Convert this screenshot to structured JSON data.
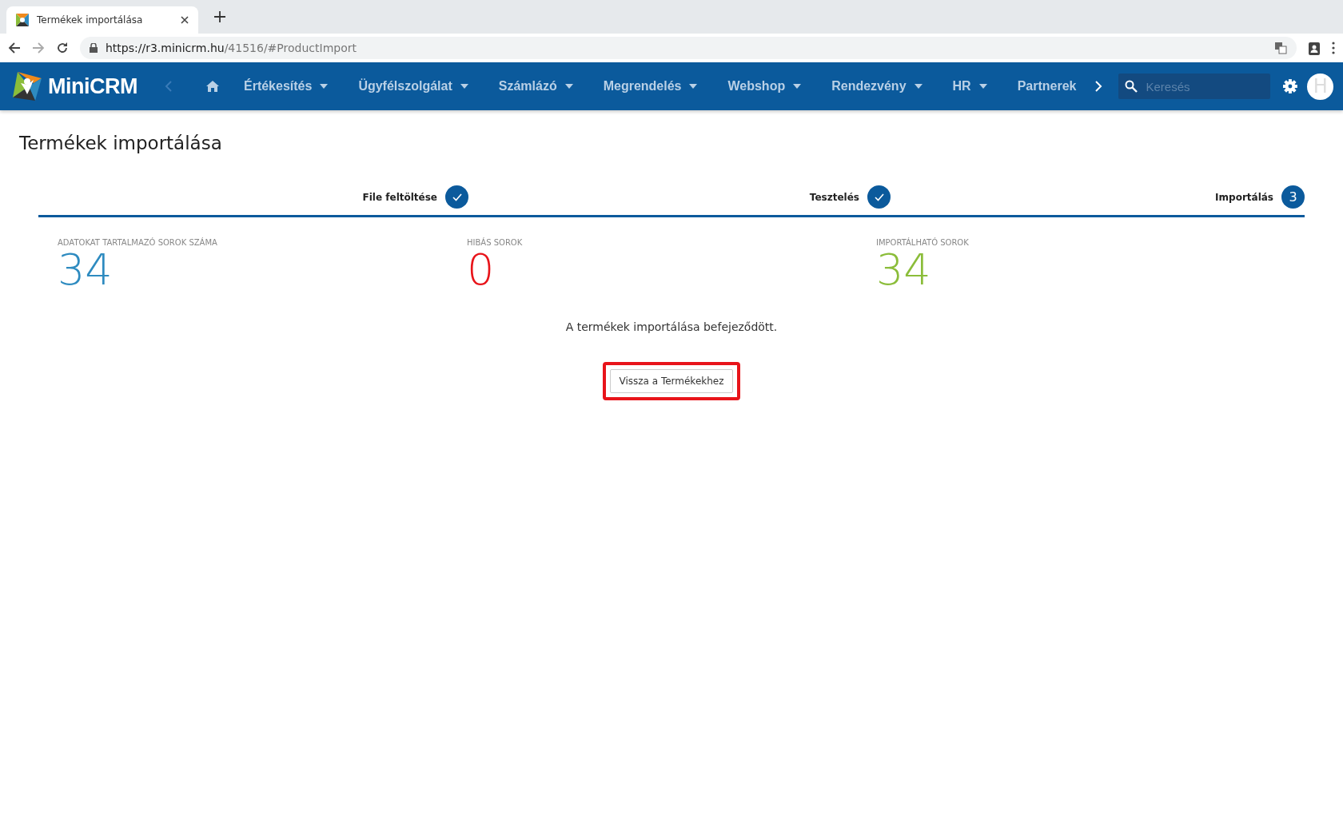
{
  "browser": {
    "tab_title": "Termékek importálása",
    "url_host": "https://r3.minicrm.hu",
    "url_path": "/41516/#ProductImport"
  },
  "nav": {
    "logo": "MiniCRM",
    "items": [
      {
        "label": "Értékesítés",
        "has_menu": true
      },
      {
        "label": "Ügyfélszolgálat",
        "has_menu": true
      },
      {
        "label": "Számlázó",
        "has_menu": true
      },
      {
        "label": "Megrendelés",
        "has_menu": true
      },
      {
        "label": "Webshop",
        "has_menu": true
      },
      {
        "label": "Rendezvény",
        "has_menu": true
      },
      {
        "label": "HR",
        "has_menu": true
      },
      {
        "label": "Partnerek",
        "has_menu": false
      }
    ],
    "search": {
      "placeholder": "Keresés"
    },
    "avatar": "H"
  },
  "page": {
    "title": "Termékek importálása",
    "steps": [
      {
        "label": "File feltöltése",
        "done": true
      },
      {
        "label": "Tesztelés",
        "done": true
      },
      {
        "label": "Importálás",
        "done": false,
        "number": "3"
      }
    ],
    "stats": [
      {
        "label": "ADATOKAT TARTALMAZÓ SOROK SZÁMA",
        "value": "34",
        "color": "#2e8bc0"
      },
      {
        "label": "HIBÁS SOROK",
        "value": "0",
        "color": "#e8141a"
      },
      {
        "label": "IMPORTÁLHATÓ SOROK",
        "value": "34",
        "color": "#8bbd3a"
      }
    ],
    "message": "A termékek importálása befejeződött.",
    "button": {
      "label": "Vissza a Termékekhez",
      "highlighted": true
    }
  }
}
